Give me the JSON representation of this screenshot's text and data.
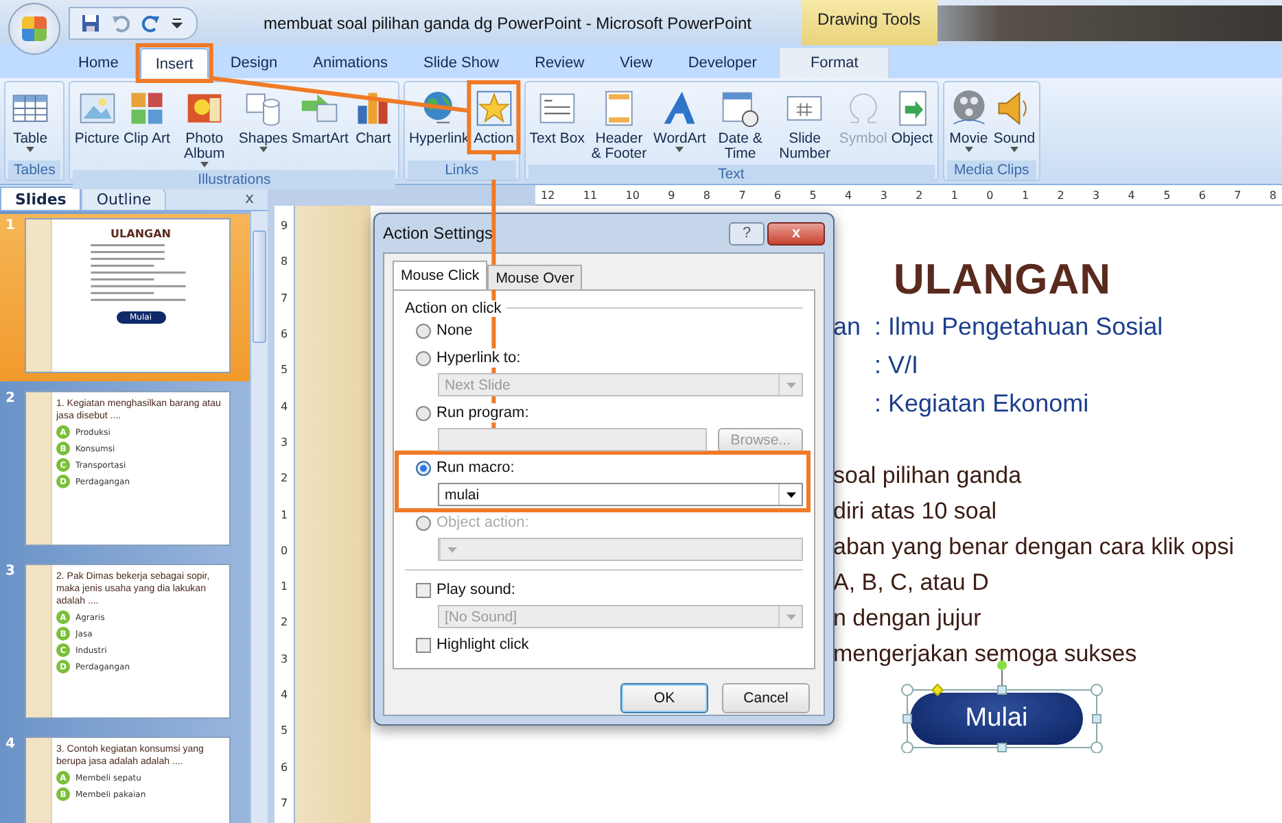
{
  "window": {
    "title": "membuat soal pilihan ganda dg PowerPoint - Microsoft PowerPoint",
    "contextual_title": "Drawing Tools"
  },
  "tabs": [
    {
      "label": "Home",
      "selected": false,
      "contextual": false
    },
    {
      "label": "Insert",
      "selected": true,
      "contextual": false
    },
    {
      "label": "Design",
      "selected": false,
      "contextual": false
    },
    {
      "label": "Animations",
      "selected": false,
      "contextual": false
    },
    {
      "label": "Slide Show",
      "selected": false,
      "contextual": false
    },
    {
      "label": "Review",
      "selected": false,
      "contextual": false
    },
    {
      "label": "View",
      "selected": false,
      "contextual": false
    },
    {
      "label": "Developer",
      "selected": false,
      "contextual": false
    },
    {
      "label": "Format",
      "selected": false,
      "contextual": true
    }
  ],
  "ribbon_groups": [
    {
      "label": "Tables",
      "buttons": [
        {
          "label": "Table",
          "dropdown": true,
          "disabled": false
        }
      ]
    },
    {
      "label": "Illustrations",
      "buttons": [
        {
          "label": "Picture",
          "dropdown": false,
          "disabled": false
        },
        {
          "label": "Clip Art",
          "dropdown": false,
          "disabled": false
        },
        {
          "label": "Photo Album",
          "dropdown": true,
          "disabled": false
        },
        {
          "label": "Shapes",
          "dropdown": true,
          "disabled": false
        },
        {
          "label": "SmartArt",
          "dropdown": false,
          "disabled": false
        },
        {
          "label": "Chart",
          "dropdown": false,
          "disabled": false
        }
      ]
    },
    {
      "label": "Links",
      "buttons": [
        {
          "label": "Hyperlink",
          "dropdown": false,
          "disabled": false
        },
        {
          "label": "Action",
          "dropdown": false,
          "disabled": false
        }
      ]
    },
    {
      "label": "Text",
      "buttons": [
        {
          "label": "Text Box",
          "dropdown": false,
          "disabled": false
        },
        {
          "label": "Header & Footer",
          "dropdown": false,
          "disabled": false
        },
        {
          "label": "WordArt",
          "dropdown": true,
          "disabled": false
        },
        {
          "label": "Date & Time",
          "dropdown": false,
          "disabled": false
        },
        {
          "label": "Slide Number",
          "dropdown": false,
          "disabled": false
        },
        {
          "label": "Symbol",
          "dropdown": false,
          "disabled": true
        },
        {
          "label": "Object",
          "dropdown": false,
          "disabled": false
        }
      ]
    },
    {
      "label": "Media Clips",
      "buttons": [
        {
          "label": "Movie",
          "dropdown": true,
          "disabled": false
        },
        {
          "label": "Sound",
          "dropdown": true,
          "disabled": false
        }
      ]
    }
  ],
  "slide_pane": {
    "tabs": [
      {
        "label": "Slides",
        "selected": true
      },
      {
        "label": "Outline",
        "selected": false
      }
    ],
    "close": "x",
    "slides": [
      {
        "number": "1",
        "selected": true,
        "kind": "cover",
        "title": "ULANGAN",
        "button": "Mulai"
      },
      {
        "number": "2",
        "selected": false,
        "kind": "question",
        "question": "1. Kegiatan menghasilkan barang atau jasa disebut ....",
        "options": [
          {
            "letter": "A",
            "text": "Produksi"
          },
          {
            "letter": "B",
            "text": "Konsumsi"
          },
          {
            "letter": "C",
            "text": "Transportasi"
          },
          {
            "letter": "D",
            "text": "Perdagangan"
          }
        ]
      },
      {
        "number": "3",
        "selected": false,
        "kind": "question",
        "question": "2. Pak Dimas bekerja sebagai sopir, maka jenis usaha yang dia lakukan adalah ....",
        "options": [
          {
            "letter": "A",
            "text": "Agraris"
          },
          {
            "letter": "B",
            "text": "Jasa"
          },
          {
            "letter": "C",
            "text": "Industri"
          },
          {
            "letter": "D",
            "text": "Perdagangan"
          }
        ]
      },
      {
        "number": "4",
        "selected": false,
        "kind": "question",
        "question": "3. Contoh kegiatan konsumsi yang berupa jasa adalah adalah ....",
        "options": [
          {
            "letter": "A",
            "text": "Membeli sepatu"
          },
          {
            "letter": "B",
            "text": "Membeli pakaian"
          }
        ]
      }
    ]
  },
  "ruler": {
    "horizontal": [
      "12",
      "11",
      "10",
      "9",
      "8",
      "7",
      "6",
      "5",
      "4",
      "3",
      "2",
      "1",
      "0",
      "1",
      "2",
      "3",
      "4",
      "5",
      "6",
      "7",
      "8"
    ],
    "vertical": [
      "9",
      "8",
      "7",
      "6",
      "5",
      "4",
      "3",
      "2",
      "1",
      "0",
      "1",
      "2",
      "3",
      "4",
      "5",
      "6",
      "7"
    ]
  },
  "slide": {
    "title": "ULANGAN",
    "info": [
      {
        "label": "an",
        "value": ": Ilmu Pengetahuan Sosial"
      },
      {
        "value": ": V/I"
      },
      {
        "value": ": Kegiatan Ekonomi"
      }
    ],
    "lines": [
      "soal pilihan ganda",
      "diri atas 10 soal",
      "aban yang benar dengan cara klik opsi",
      "A, B, C,  atau D",
      "n dengan jujur",
      "mengerjakan semoga sukses"
    ],
    "button": "Mulai"
  },
  "dialog": {
    "title": "Action Settings",
    "help": "?",
    "close": "x",
    "tabs": [
      {
        "label": "Mouse Click",
        "selected": true
      },
      {
        "label": "Mouse Over",
        "selected": false
      }
    ],
    "group": "Action on click",
    "options": [
      {
        "label": "None",
        "selected": false,
        "disabled": false
      },
      {
        "label": "Hyperlink to:",
        "selected": false,
        "disabled": false,
        "control": {
          "kind": "select",
          "value": "Next Slide",
          "disabled": true
        }
      },
      {
        "label": "Run program:",
        "selected": false,
        "disabled": false,
        "control": {
          "kind": "browse",
          "button": "Browse...",
          "disabled": true
        }
      },
      {
        "label": "Run macro:",
        "selected": true,
        "disabled": false,
        "control": {
          "kind": "select",
          "value": "mulai",
          "disabled": false
        }
      },
      {
        "label": "Object action:",
        "selected": false,
        "disabled": true,
        "control": {
          "kind": "select",
          "disabled": true
        }
      }
    ],
    "checks": [
      {
        "label": "Play sound:",
        "checked": false,
        "control": {
          "kind": "select",
          "value": "[No Sound]",
          "disabled": true
        }
      },
      {
        "label": "Highlight click",
        "checked": false
      }
    ],
    "buttons": [
      {
        "label": "OK",
        "default": true
      },
      {
        "label": "Cancel",
        "default": false
      }
    ]
  }
}
